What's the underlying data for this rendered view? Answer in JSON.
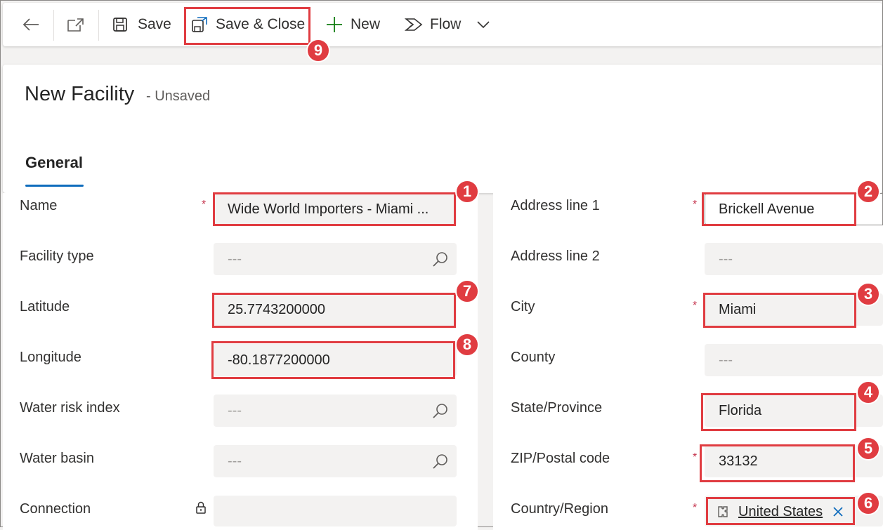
{
  "toolbar": {
    "back_icon": "back-arrow-icon",
    "popout_icon": "open-in-new-window-icon",
    "save_label": "Save",
    "save_close_label": "Save & Close",
    "new_label": "New",
    "flow_label": "Flow"
  },
  "header": {
    "title": "New Facility",
    "status": "- Unsaved",
    "tabs": [
      {
        "label": "General",
        "selected": true
      }
    ]
  },
  "form": {
    "left": {
      "name": {
        "label": "Name",
        "required": "*",
        "value": "Wide World Importers - Miami ..."
      },
      "facility_type": {
        "label": "Facility type",
        "placeholder": "---"
      },
      "latitude": {
        "label": "Latitude",
        "value": "25.7743200000"
      },
      "longitude": {
        "label": "Longitude",
        "value": "-80.1877200000"
      },
      "water_risk_index": {
        "label": "Water risk index",
        "placeholder": "---"
      },
      "water_basin": {
        "label": "Water basin",
        "placeholder": "---"
      },
      "connection": {
        "label": "Connection"
      }
    },
    "right": {
      "address_line_1": {
        "label": "Address line 1",
        "required": "*",
        "value": "Brickell Avenue"
      },
      "address_line_2": {
        "label": "Address line 2",
        "placeholder": "---"
      },
      "city": {
        "label": "City",
        "required": "*",
        "value": "Miami"
      },
      "county": {
        "label": "County",
        "placeholder": "---"
      },
      "state": {
        "label": "State/Province",
        "value": "Florida"
      },
      "zip": {
        "label": "ZIP/Postal code",
        "required": "*",
        "value": "33132"
      },
      "country": {
        "label": "Country/Region",
        "required": "*",
        "value": "United States"
      }
    }
  },
  "annotations": [
    "1",
    "2",
    "3",
    "4",
    "5",
    "6",
    "7",
    "8",
    "9"
  ],
  "colors": {
    "highlight": "#e03c41",
    "link": "#0f6cbd",
    "required": "#c4314b",
    "new_plus": "#107c10",
    "tab_underline": "#0f6cbd"
  }
}
